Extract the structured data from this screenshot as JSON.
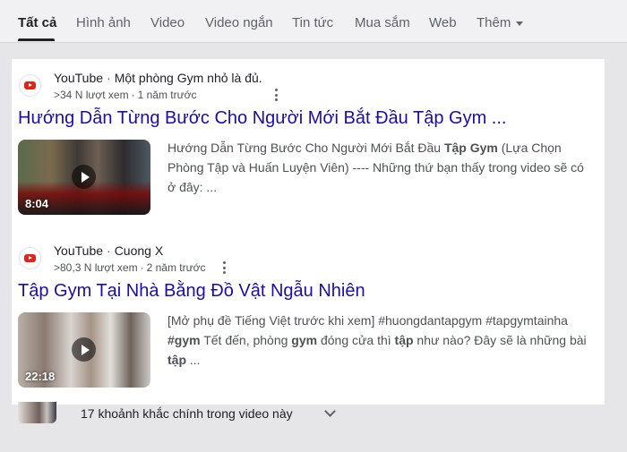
{
  "tabs": [
    "Tất cả",
    "Hình ảnh",
    "Video",
    "Video ngắn",
    "Tin tức",
    "Mua sắm",
    "Web",
    "Thêm"
  ],
  "results": [
    {
      "source": "YouTube",
      "channel": "Một phòng Gym nhỏ là đủ.",
      "views": ">34 N lượt xem",
      "age": "1 năm trước",
      "title": "Hướng Dẫn Từng Bước Cho Người Mới Bắt Đầu Tập Gym ...",
      "duration": "8:04",
      "snippet": [
        {
          "t": "Hướng Dẫn Từng Bước Cho Người Mới Bắt Đầu ",
          "b": false
        },
        {
          "t": "Tập Gym",
          "b": true
        },
        {
          "t": " (Lựa Chọn Phòng Tập và Huấn Luyện Viên) ---- Những thứ bạn thấy trong video sẽ có ở đây: ...",
          "b": false
        }
      ]
    },
    {
      "source": "YouTube",
      "channel": "Cuong X",
      "views": ">80,3 N lượt xem",
      "age": "2 năm trước",
      "title": "Tập Gym Tại Nhà Bằng Đồ Vật Ngẫu Nhiên",
      "duration": "22:18",
      "snippet": [
        {
          "t": "[Mở phụ đề Tiếng Việt trước khi xem] #huongdantapgym #tapgymtainha ",
          "b": false
        },
        {
          "t": "#gym",
          "b": true
        },
        {
          "t": " Tết đến, phòng ",
          "b": false
        },
        {
          "t": "gym",
          "b": true
        },
        {
          "t": " đóng cửa thì ",
          "b": false
        },
        {
          "t": "tập",
          "b": true
        },
        {
          "t": " như nào? Đây sẽ là những bài ",
          "b": false
        },
        {
          "t": "tập",
          "b": true
        },
        {
          "t": " ...",
          "b": false
        }
      ]
    }
  ],
  "key_moments": "17 khoảnh khắc chính trong video này",
  "colors": {
    "link": "#1a0dab",
    "text": "#4d5156",
    "background": "#e6e6e8",
    "youtube_red": "#e62117"
  },
  "icons": [
    "youtube-icon",
    "more-vert-icon",
    "play-icon",
    "chevron-down-icon",
    "caret-down-icon"
  ]
}
